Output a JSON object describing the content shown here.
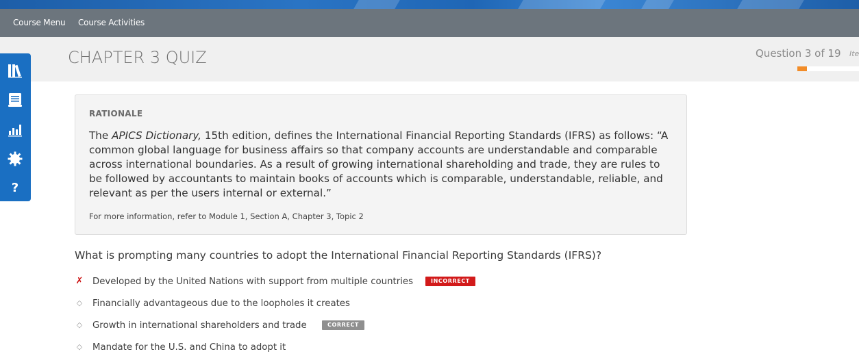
{
  "nav": {
    "course_menu": "Course Menu",
    "course_activities": "Course Activities"
  },
  "header": {
    "title": "CHAPTER 3 QUIZ",
    "question_counter": "Question 3 of 19",
    "item_label_truncated": "Ite",
    "progress_fraction": 0.158
  },
  "sidebar": {
    "icons": [
      "library-icon",
      "notebook-icon",
      "bar-chart-icon",
      "gear-icon",
      "help-icon"
    ],
    "help_glyph": "?"
  },
  "rationale": {
    "heading": "RATIONALE",
    "body_prefix": "The ",
    "body_italic": "APICS Dictionary,",
    "body_rest": " 15th edition, defines the International Financial Reporting Standards (IFRS) as follows: “A common global language for business affairs so that company accounts are understandable and comparable across international boundaries. As a result of growing international shareholding and trade, they are rules to be followed by accountants to maintain books of accounts which is comparable, understandable, reliable, and relevant as per the users internal or external.”",
    "reference": "For more information, refer to Module 1, Section A, Chapter 3, Topic 2"
  },
  "question": {
    "text": "What is prompting many countries to adopt the International Financial Reporting Standards (IFRS)?",
    "options": [
      {
        "text": "Developed by the United Nations with support from multiple countries",
        "mark": "✗",
        "badge": "INCORRECT"
      },
      {
        "text": "Financially advantageous due to the loopholes it creates",
        "mark": "◇",
        "badge": ""
      },
      {
        "text": "Growth in international shareholders and trade",
        "mark": "◇",
        "badge": "CORRECT"
      },
      {
        "text": "Mandate for the U.S. and China to adopt it",
        "mark": "◇",
        "badge": ""
      }
    ]
  },
  "colors": {
    "nav_bg": "#6c757d",
    "sidebar_bg": "#1a6fc2",
    "progress": "#f28c28",
    "incorrect": "#d21a1a",
    "correct_badge": "#8f8f8f"
  }
}
